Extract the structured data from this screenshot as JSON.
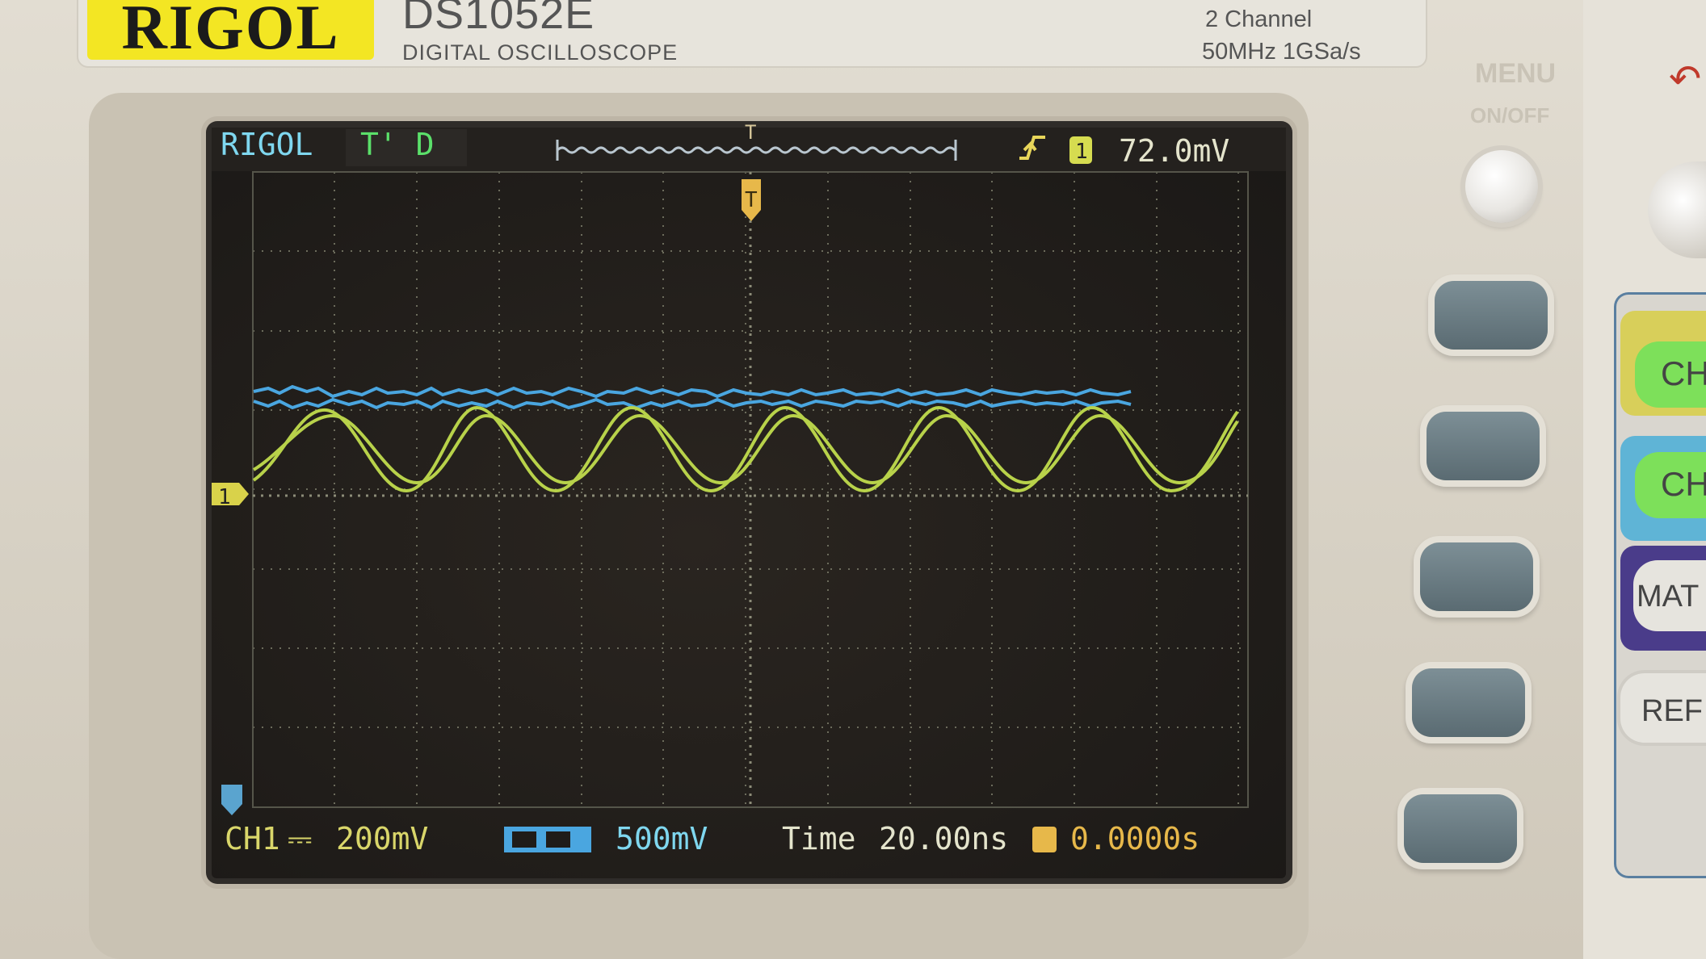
{
  "header": {
    "brand": "RIGOL",
    "model": "DS1052E",
    "model_subtitle": "DIGITAL OSCILLOSCOPE",
    "spec_line1": "2 Channel",
    "spec_line2": "50MHz 1GSa/s"
  },
  "screen": {
    "brand": "RIGOL",
    "trigger_status": "T' D",
    "trigger_value": "72.0mV",
    "ch1_label": "CH1",
    "ch1_coupling_symbol": "⎓",
    "ch1_scale": "200mV",
    "ch2_scale": "500mV",
    "time_label": "Time",
    "timebase": "20.00ns",
    "trigger_offset": "0.0000s",
    "ch1_marker": "1",
    "trigger_marker": "T",
    "colors": {
      "ch1": "#b8d24a",
      "ch2": "#4aa6e0",
      "trigger": "#e7b84a",
      "grid": "#6c6c5c",
      "text_cyan": "#7fd7ef",
      "text_yellow": "#d9d66a"
    }
  },
  "panel": {
    "menu_label": "MENU",
    "onoff_label": "ON/OFF",
    "right_buttons": [
      "CH",
      "CH",
      "MAT",
      "REF"
    ]
  },
  "icons": {
    "edge": "rising-edge-icon",
    "ch1_badge": "ch1-badge-icon",
    "ch2_badge": "ch2-badge-icon",
    "trigger_offset": "trigger-offset-icon",
    "ground_marker": "ground-marker-icon"
  }
}
